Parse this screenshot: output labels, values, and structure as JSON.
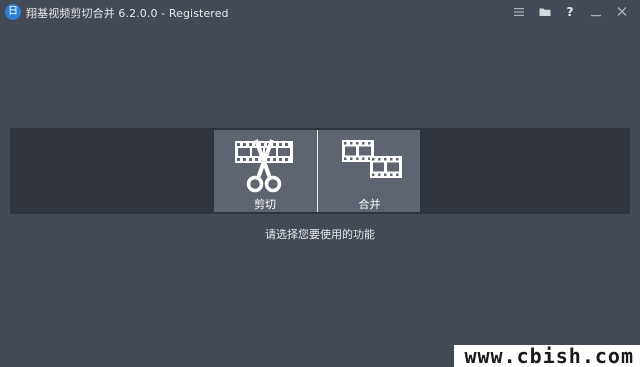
{
  "window": {
    "title": "翔基视频剪切合并 6.2.0.0 - Registered",
    "logo_glyph": "日"
  },
  "title_buttons": [
    {
      "name": "menu-icon",
      "glyph": "☰"
    },
    {
      "name": "folder-icon",
      "glyph": ""
    },
    {
      "name": "help-icon",
      "glyph": "?"
    },
    {
      "name": "minimize-icon",
      "glyph": "—"
    },
    {
      "name": "close-icon",
      "glyph": "✕"
    }
  ],
  "features": {
    "cut_label": "剪切",
    "merge_label": "合并"
  },
  "prompt": "请选择您要使用的功能",
  "watermark": "www.cbish.com",
  "colors": {
    "background": "#434a55",
    "band": "#2f343d",
    "card": "#5f6570",
    "logo": "#2e7fd6"
  }
}
